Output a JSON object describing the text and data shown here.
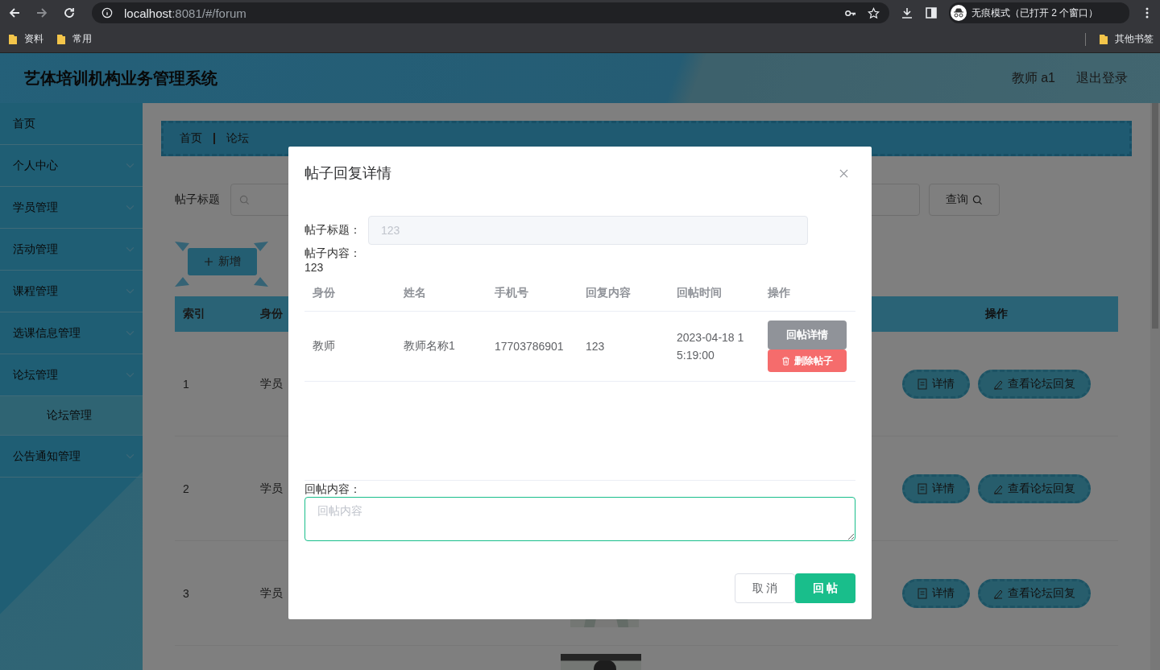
{
  "browser": {
    "url_host": "localhost",
    "url_rest": ":8081/#/forum",
    "incognito": "无痕模式（已打开 2 个窗口）",
    "bookmarks": [
      "资料",
      "常用"
    ],
    "other_bookmarks": "其他书签"
  },
  "header": {
    "title": "艺体培训机构业务管理系统",
    "user": "教师 a1",
    "logout": "退出登录"
  },
  "sidebar": {
    "items": [
      {
        "label": "首页",
        "expandable": false
      },
      {
        "label": "个人中心",
        "expandable": true
      },
      {
        "label": "学员管理",
        "expandable": true
      },
      {
        "label": "活动管理",
        "expandable": true
      },
      {
        "label": "课程管理",
        "expandable": true
      },
      {
        "label": "选课信息管理",
        "expandable": true
      },
      {
        "label": "论坛管理",
        "expandable": true,
        "expanded": true,
        "children": [
          {
            "label": "论坛管理"
          }
        ]
      },
      {
        "label": "公告通知管理",
        "expandable": true
      }
    ]
  },
  "breadcrumb": [
    "首页",
    "论坛"
  ],
  "search": {
    "label": "帖子标题",
    "button": "查询"
  },
  "add_button": "新增",
  "table": {
    "columns": [
      "索引",
      "身份"
    ],
    "actions_column": "操作",
    "rows": [
      {
        "index": "1",
        "role": "学员",
        "actions": [
          "详情",
          "查看论坛回复"
        ]
      },
      {
        "index": "2",
        "role": "学员",
        "actions": [
          "详情",
          "查看论坛回复"
        ]
      },
      {
        "index": "3",
        "role": "学员",
        "actions": [
          "详情",
          "查看论坛回复"
        ],
        "picture": true
      },
      {
        "picture": true
      }
    ]
  },
  "modal": {
    "title": "帖子回复详情",
    "fields": [
      {
        "label": "帖子标题：",
        "value": "123",
        "kind": "input"
      },
      {
        "label": "帖子内容：",
        "value": "123",
        "kind": "text"
      }
    ],
    "replies": {
      "columns": [
        "身份",
        "姓名",
        "手机号",
        "回复内容",
        "回帖时间",
        "操作"
      ],
      "rows": [
        {
          "cells": [
            "教师",
            "教师名称1",
            "17703786901",
            "123",
            "2023-04-18 15:19:00"
          ],
          "actions": [
            {
              "label": "回帖详情",
              "kind": "detail"
            },
            {
              "label": "删除帖子",
              "kind": "delete"
            }
          ]
        }
      ]
    },
    "reply": {
      "label": "回帖内容：",
      "placeholder": "回帖内容"
    },
    "buttons": [
      {
        "label": "取 消",
        "kind": "cancel"
      },
      {
        "label": "回 帖",
        "kind": "primary"
      }
    ]
  }
}
